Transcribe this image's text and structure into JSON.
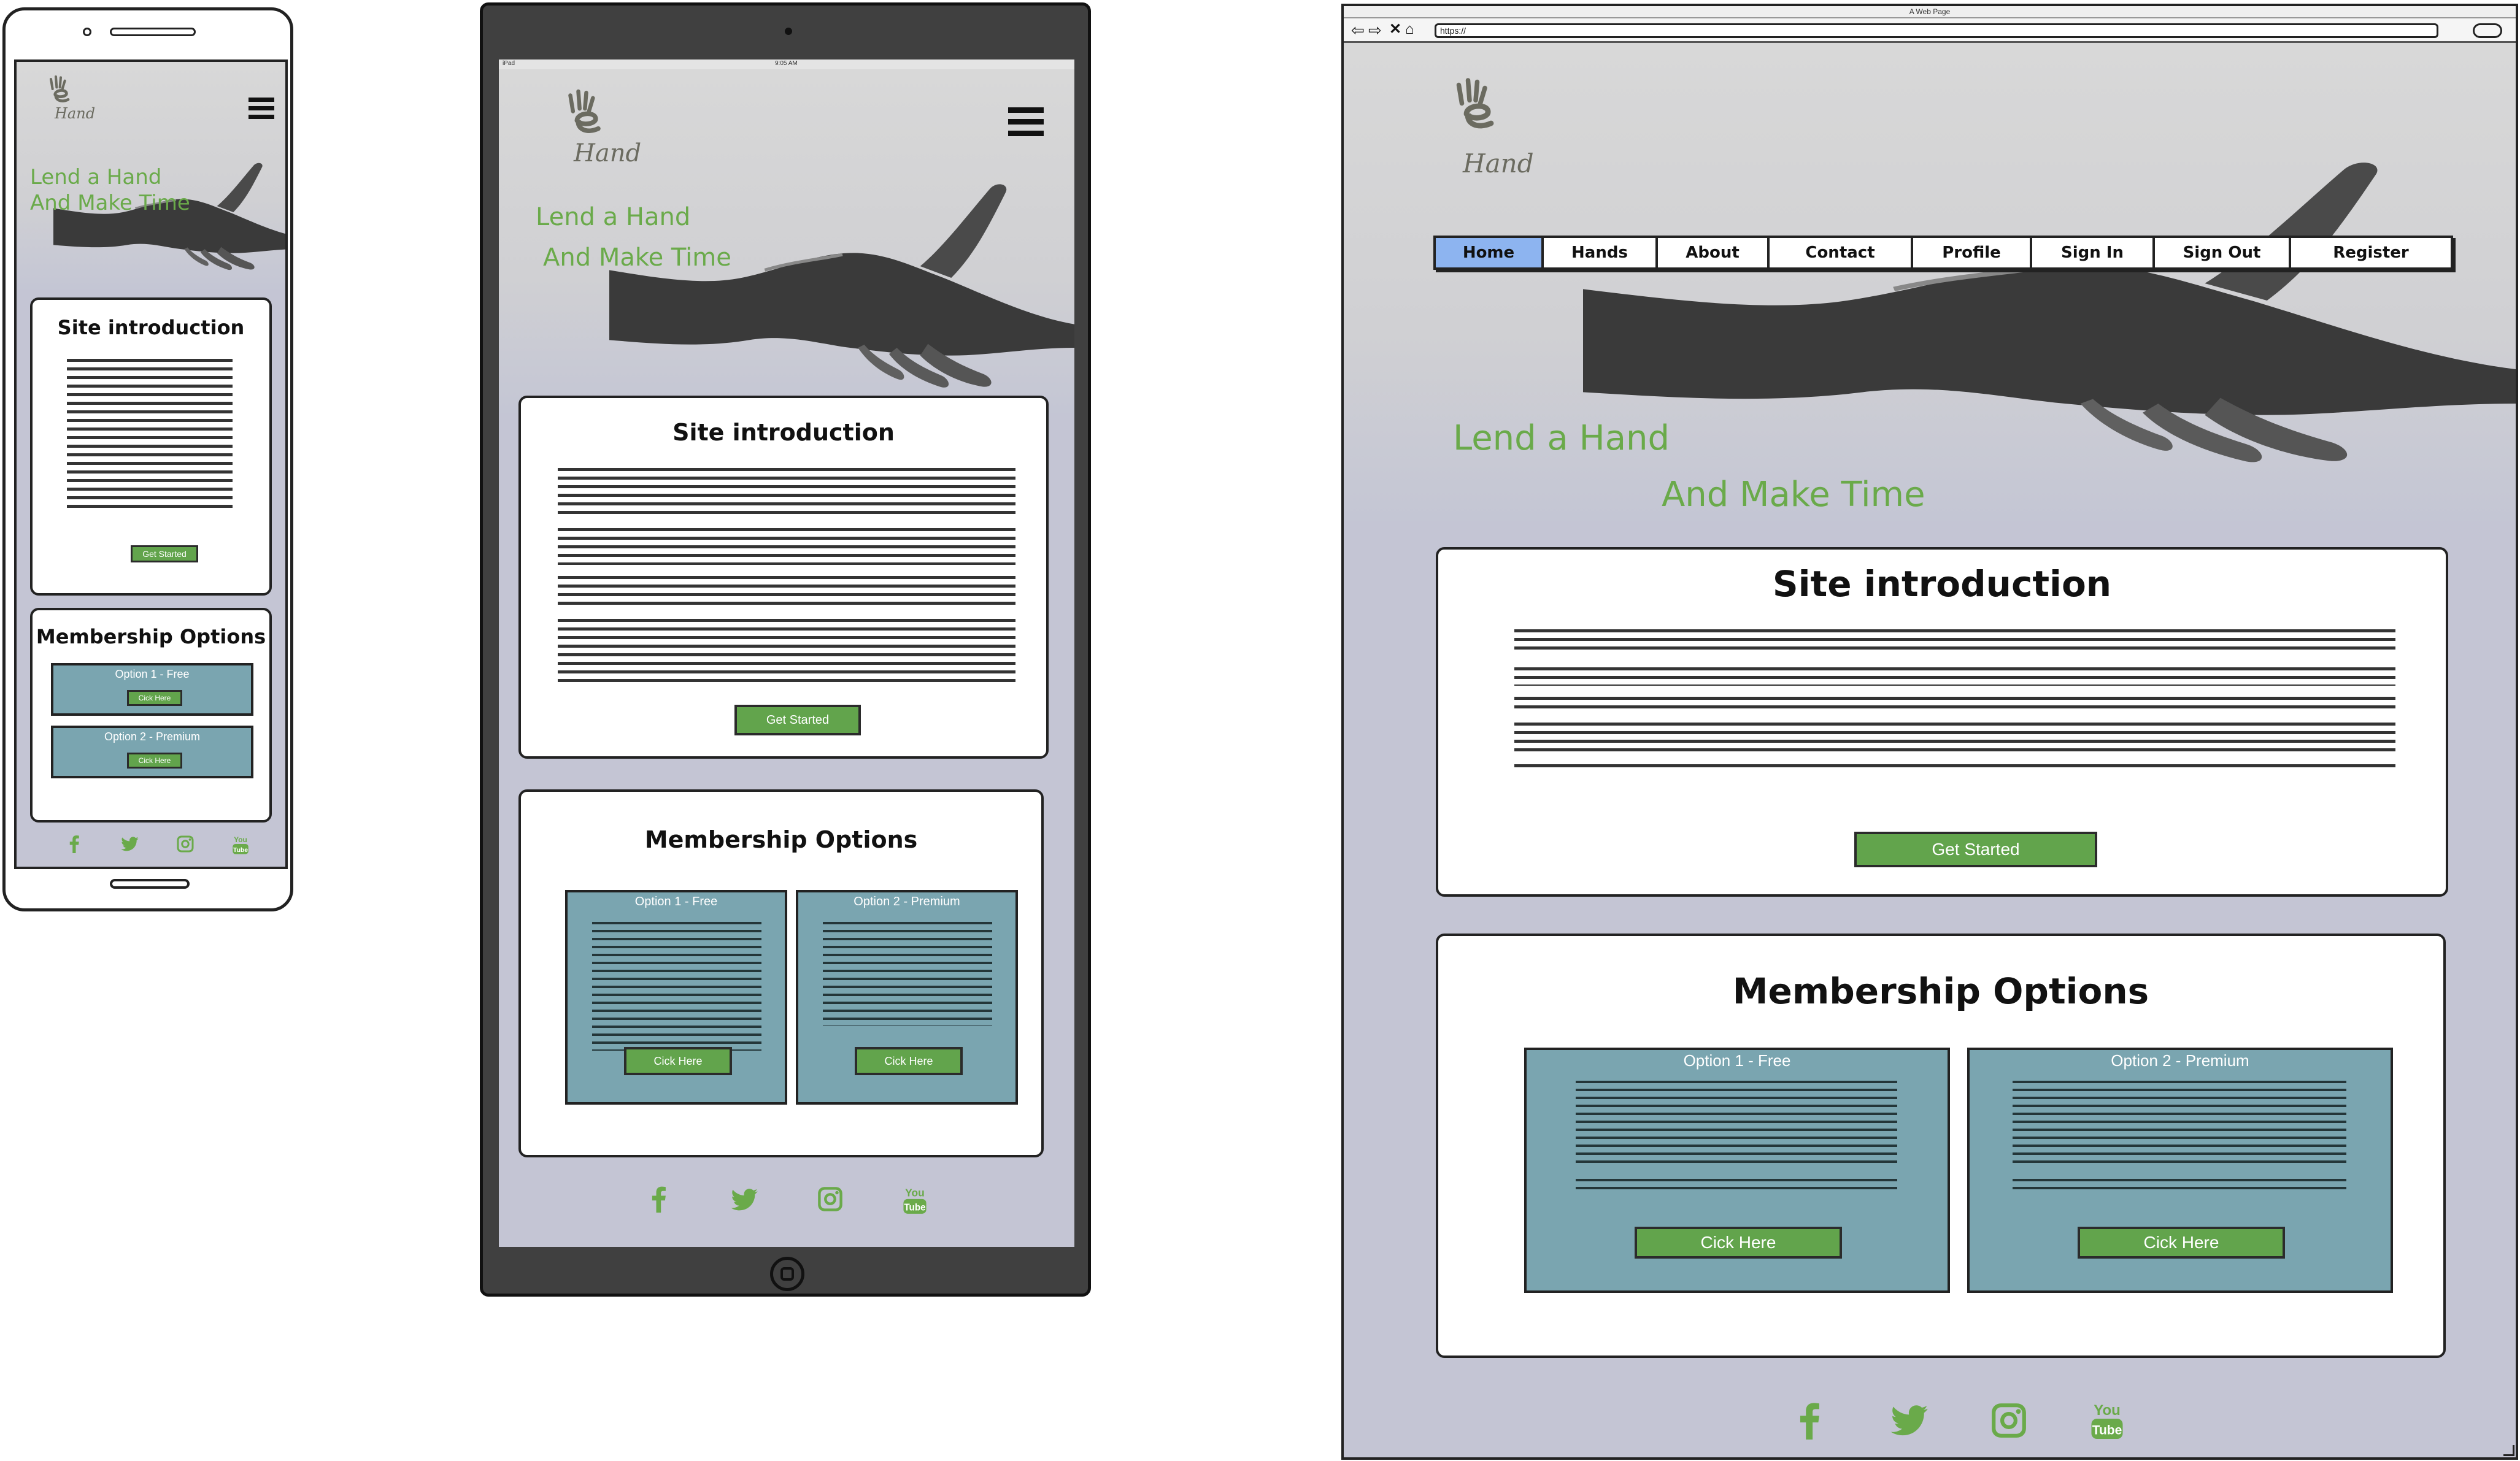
{
  "brand": {
    "logo_text": "Hand",
    "tagline_line1": "Lend a Hand",
    "tagline_line2": "And Make Time",
    "mobile_tagline_line1": "Lend a Hand",
    "mobile_tagline_line2": "And Make Time"
  },
  "browser": {
    "window_title": "A Web Page",
    "url": "https://"
  },
  "device_status": {
    "tablet_left": "iPad",
    "tablet_time": "9:05 AM"
  },
  "nav": {
    "items": [
      "Home",
      "Hands",
      "About",
      "Contact",
      "Profile",
      "Sign In",
      "Sign Out",
      "Register"
    ],
    "active": "Home"
  },
  "intro": {
    "title": "Site introduction",
    "button_label": "Get Started"
  },
  "membership": {
    "title": "Membership Options",
    "options": [
      {
        "name": "Option 1 - Free",
        "button_label": "Cick Here"
      },
      {
        "name": "Option 2 - Premium",
        "button_label": "Cick Here"
      }
    ]
  },
  "social": [
    "facebook-icon",
    "twitter-icon",
    "instagram-icon",
    "youtube-icon"
  ],
  "colors": {
    "brand_green": "#6aaa4a",
    "button_green": "#62a44c",
    "option_teal": "#7aa5b0",
    "page_background": "#c4c5d4",
    "nav_active": "#8db4f0"
  }
}
